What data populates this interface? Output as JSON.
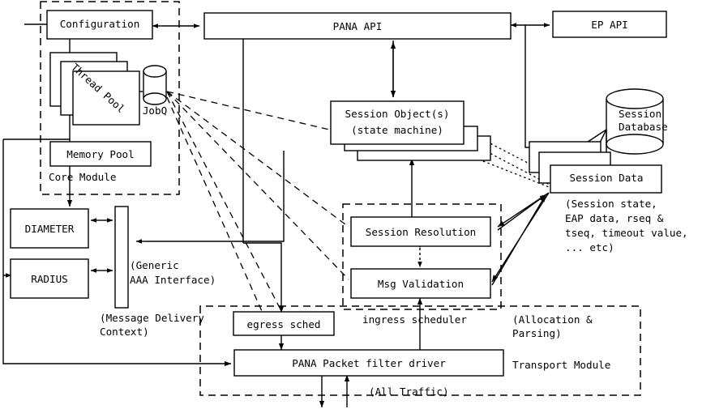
{
  "diagram": {
    "title": "PANA implementation architecture block diagram",
    "type": "architecture-block-diagram",
    "background": "#ffffff",
    "line_color": "#000000"
  },
  "boxes": {
    "configuration": "Configuration",
    "pana_api": "PANA API",
    "ep_api": "EP API",
    "thread_pool": "Thread Pool",
    "jobq": "JobQ",
    "memory_pool": "Memory Pool",
    "core_module": "Core Module",
    "session_object_line1": "Session Object(s)",
    "session_object_line2": "(state machine)",
    "session_database_line1": "Session",
    "session_database_line2": "Database",
    "session_data": "Session Data",
    "diameter": "DIAMETER",
    "radius": "RADIUS",
    "generic_aaa_line1": "(Generic",
    "generic_aaa_line2": "AAA Interface)",
    "session_resolution": "Session Resolution",
    "msg_validation": "Msg Validation",
    "egress_sched": "egress sched",
    "ingress_scheduler": "ingress scheduler",
    "pana_packet_filter_driver": "PANA Packet filter driver",
    "transport_module": "Transport Module"
  },
  "annotations": {
    "session_data_detail_line1": "(Session state,",
    "session_data_detail_line2": "EAP data, rseq &",
    "session_data_detail_line3": "tseq, timeout value,",
    "session_data_detail_line4": "... etc)",
    "message_delivery_line1": "(Message Delivery",
    "message_delivery_line2": "Context)",
    "allocation_parsing_line1": "(Allocation &",
    "allocation_parsing_line2": "Parsing)",
    "all_traffic": "(All Traffic)"
  }
}
